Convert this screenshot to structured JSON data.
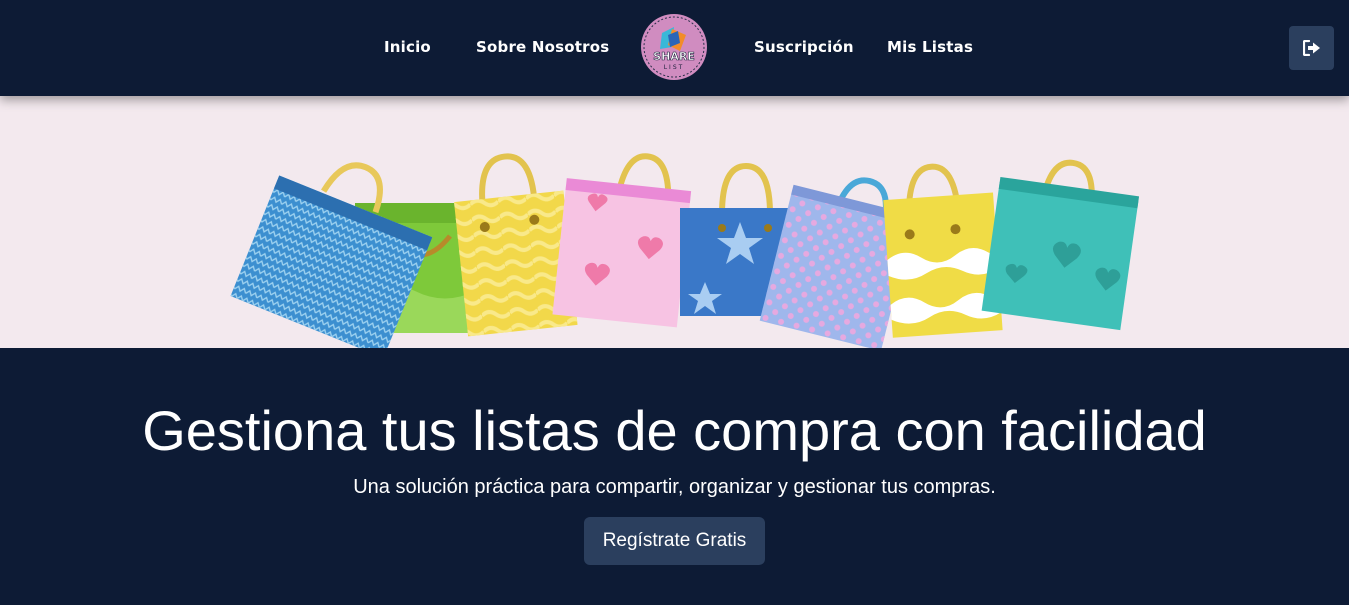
{
  "nav": {
    "links": [
      {
        "label": "Inicio"
      },
      {
        "label": "Sobre Nosotros"
      },
      {
        "label": "Suscripción"
      },
      {
        "label": "Mis Listas"
      }
    ],
    "logo": {
      "text_top": "SHARE",
      "text_bottom": "LIST"
    },
    "logout_icon": "sign-out-icon"
  },
  "hero": {
    "illustration": "shopping-bags"
  },
  "main": {
    "headline": "Gestiona tus listas de compra con facilidad",
    "subtitle": "Una solución práctica para compartir, organizar y gestionar tus compras.",
    "cta_label": "Regístrate Gratis"
  },
  "colors": {
    "background": "#0d1b35",
    "hero_background": "#f3e9ee",
    "button": "#2b3f5e",
    "logo_pink": "#d08cc0"
  }
}
